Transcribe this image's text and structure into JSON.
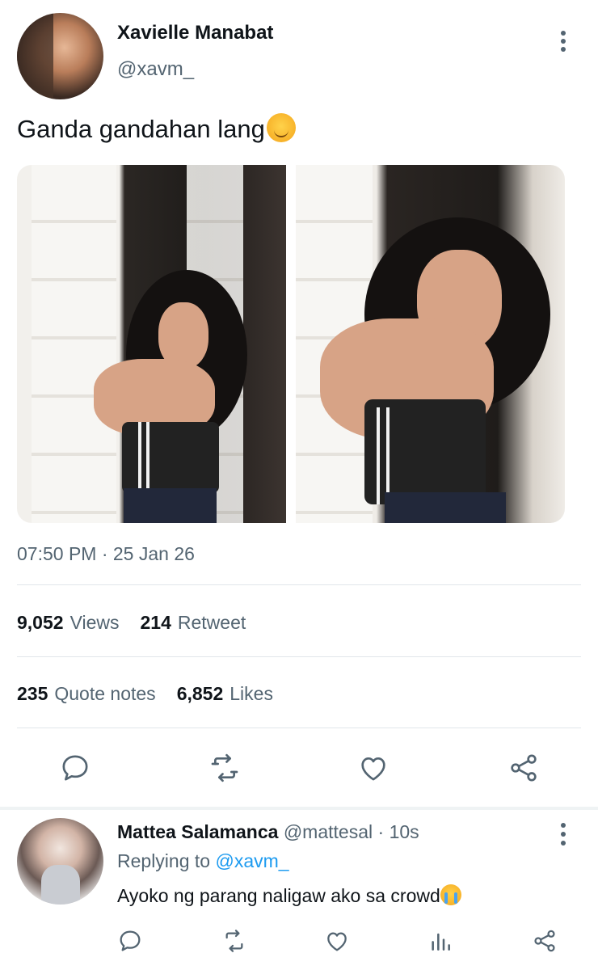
{
  "tweet": {
    "author_name": "Xavielle Manabat",
    "author_handle": "@xavm_",
    "text": "Ganda gandahan lang",
    "text_emoji": "smiling-face-icon",
    "timestamp": "07:50 PM · 25 Jan 26",
    "stats": {
      "views_count": "9,052",
      "views_label": "Views",
      "retweet_count": "214",
      "retweet_label": "Retweet",
      "quote_count": "235",
      "quote_label": "Quote notes",
      "likes_count": "6,852",
      "likes_label": "Likes"
    },
    "actions": [
      "reply-icon",
      "retweet-icon",
      "like-icon",
      "share-icon"
    ]
  },
  "reply": {
    "author_name": "Mattea Salamanca",
    "author_handle": "@mattesal",
    "separator": "·",
    "time": "10s",
    "replying_prefix": "Replying to",
    "replying_handle": "@xavm_",
    "text": "Ayoko ng parang naligaw ako sa crowd",
    "text_emoji": "crying-face-icon",
    "actions": [
      "reply-icon",
      "retweet-icon",
      "like-icon",
      "analytics-icon",
      "share-icon"
    ]
  },
  "colors": {
    "text_primary": "#0f1419",
    "text_secondary": "#536471",
    "link": "#1d9bf0",
    "divider": "#e1e6ea"
  }
}
